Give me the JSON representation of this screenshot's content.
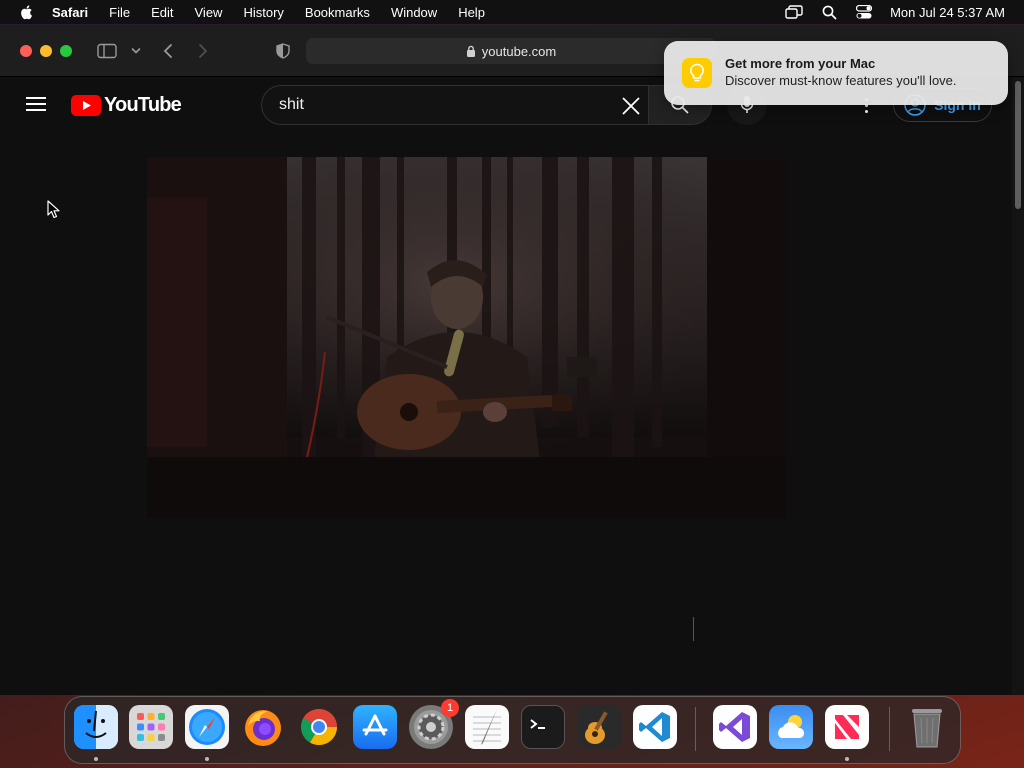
{
  "menubar": {
    "app_name": "Safari",
    "menus": [
      "File",
      "Edit",
      "View",
      "History",
      "Bookmarks",
      "Window",
      "Help"
    ],
    "clock": "Mon Jul 24  5:37 AM",
    "status_icons": [
      "screen-mirroring-icon",
      "spotlight-search-icon",
      "control-center-icon"
    ]
  },
  "browser": {
    "url": "youtube.com"
  },
  "youtube": {
    "logo_text": "YouTube",
    "search_value": "shit",
    "signin_label": "Sign in"
  },
  "notification": {
    "title": "Get more from your Mac",
    "body": "Discover must-know features you'll love."
  },
  "dock": {
    "apps": [
      "Finder",
      "Launchpad",
      "Safari",
      "Firefox",
      "Google Chrome",
      "App Store",
      "System Settings",
      "TextEdit",
      "Terminal",
      "GarageBand",
      "Visual Studio Code",
      "Visual Studio",
      "Weather",
      "News",
      "Trash"
    ],
    "settings_badge": "1"
  },
  "colors": {
    "youtube_red": "#ff0000",
    "link_blue": "#3ea6ff",
    "page_bg": "#0f0f0f"
  }
}
